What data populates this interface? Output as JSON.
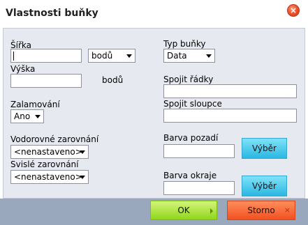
{
  "dialog": {
    "title": "Vlastnosti buňky",
    "close_glyph": "×"
  },
  "form": {
    "width_label": "Šířka",
    "width_value": "",
    "width_unit": "bodů",
    "height_label": "Výška",
    "height_value": "",
    "height_unit": "bodů",
    "wrap_label": "Zalamování",
    "wrap_value": "Ano",
    "halign_label": "Vodorovné zarovnání",
    "halign_value": "<nenastaveno>",
    "valign_label": "Svislé zarovnání",
    "valign_value": "<nenastaveno>",
    "celltype_label": "Typ buňky",
    "celltype_value": "Data",
    "rowspan_label": "Spojit řádky",
    "rowspan_value": "",
    "colspan_label": "Spojit sloupce",
    "colspan_value": "",
    "bgcolor_label": "Barva pozadí",
    "bgcolor_value": "",
    "bgcolor_button": "Výběr",
    "bordercolor_label": "Barva okraje",
    "bordercolor_value": "",
    "bordercolor_button": "Výběr"
  },
  "footer": {
    "ok_label": "OK",
    "cancel_label": "Storno",
    "cancel_glyph": "×"
  },
  "colors": {
    "panel": "#e6eaf0",
    "footer": "#9aa8be",
    "ok": "#a6e33a",
    "cancel": "#f5672f",
    "select_button": "#3fc2ea"
  }
}
